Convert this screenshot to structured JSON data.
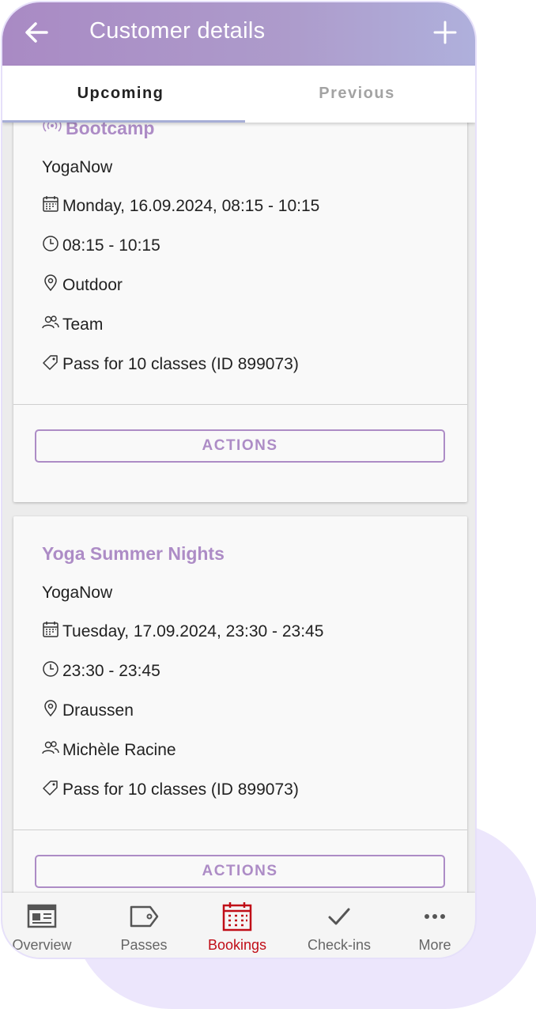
{
  "appbar": {
    "title": "Customer details",
    "back_icon": "arrow-left-icon",
    "add_icon": "plus-icon",
    "gradient_start": "#a98ac4",
    "gradient_end": "#afb0dc"
  },
  "tabs": [
    {
      "label": "Upcoming",
      "active": true
    },
    {
      "label": "Previous",
      "active": false
    }
  ],
  "bookings": [
    {
      "name": "Bootcamp",
      "live": true,
      "organizer": "YogaNow",
      "date": "Monday, 16.09.2024, 08:15 - 10:15",
      "time": "08:15 - 10:15",
      "location": "Outdoor",
      "instructor": "Team",
      "pass": "Pass for 10 classes (ID 899073)",
      "actions_label": "ACTIONS"
    },
    {
      "name": "Yoga Summer Nights",
      "live": false,
      "organizer": "YogaNow",
      "date": "Tuesday, 17.09.2024, 23:30 - 23:45",
      "time": "23:30 - 23:45",
      "location": "Draussen",
      "instructor": "Michèle Racine",
      "pass": "Pass for 10 classes (ID 899073)",
      "actions_label": "ACTIONS"
    }
  ],
  "bottom_nav": [
    {
      "label": "Overview",
      "icon": "newspaper-icon",
      "active": false
    },
    {
      "label": "Passes",
      "icon": "tag-icon",
      "active": false
    },
    {
      "label": "Bookings",
      "icon": "calendar-icon",
      "active": true
    },
    {
      "label": "Check-ins",
      "icon": "checkmark-icon",
      "active": false
    },
    {
      "label": "More",
      "icon": "more-dots-icon",
      "active": false
    }
  ],
  "colors": {
    "accent": "#ad8cc6",
    "active_nav": "#c00d17",
    "background_blob": "#ece6fc"
  }
}
